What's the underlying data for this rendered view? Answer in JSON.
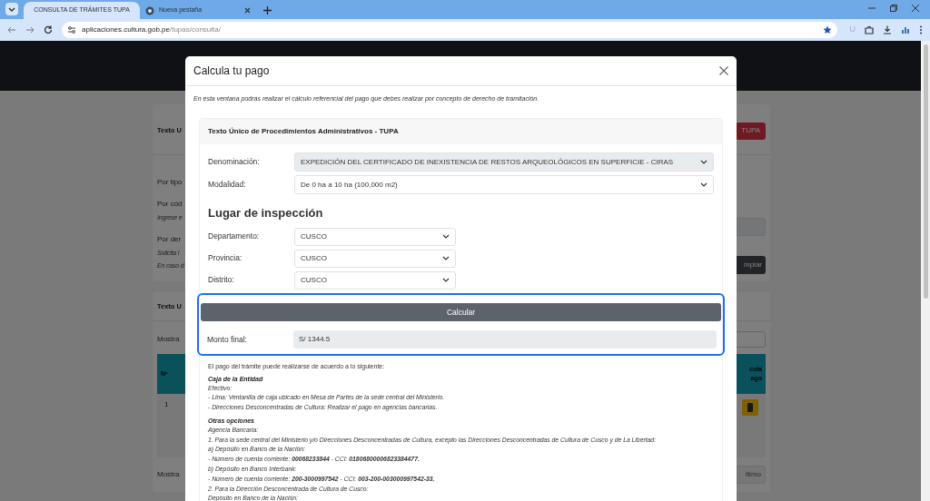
{
  "browser": {
    "tabs": [
      {
        "title": "CONSULTA DE TRÁMITES TUPA",
        "selected": true,
        "kind": "site"
      },
      {
        "title": "Nueva pestaña",
        "selected": false,
        "kind": "globe"
      }
    ],
    "url": {
      "host": "aplicaciones.cultura.gob.pe",
      "path": "/tupas/consulta/"
    },
    "profile_letter": "U"
  },
  "background_page": {
    "search_card": {
      "title": "Texto U",
      "tupa_button": "TUPA",
      "lines": [
        {
          "kind": "label",
          "text": "Por tipo"
        },
        {
          "kind": "label",
          "text": "Por cód"
        },
        {
          "kind": "hint",
          "text": "Ingrese e"
        },
        {
          "kind": "label",
          "text": "Por der"
        },
        {
          "kind": "hint",
          "text": "Solicita l"
        },
        {
          "kind": "hint",
          "text": "En caso d"
        }
      ],
      "clear_button": "mpiar"
    },
    "results_card": {
      "title": "Texto U",
      "show_label": "Mostra",
      "columns": {
        "number": "Nº",
        "last": [
          "cula",
          "ago"
        ]
      },
      "row_number": "1",
      "footer_label": "Mostra",
      "last_button": "ltimo"
    }
  },
  "modal": {
    "title": "Calcula tu pago",
    "intro": "En esta ventana podrás realizar el cálculo referencial del pago que debes realizar por concepto de derecho de tramitación.",
    "section_title": "Texto Único de Procedimientos Administrativos - TUPA",
    "fields": [
      {
        "label": "Denominación:",
        "value": "EXPEDICIÓN DEL CERTIFICADO DE INEXISTENCIA DE RESTOS ARQUEOLÓGICOS EN SUPERFICIE - CIRAS",
        "disabled": true
      },
      {
        "label": "Modalidad:",
        "value": "De 0 ha a 10 ha (100,000 m2)",
        "disabled": false
      }
    ],
    "location_title": "Lugar de inspección",
    "location_fields": [
      {
        "label": "Departamento:",
        "value": "CUSCO"
      },
      {
        "label": "Provincia:",
        "value": "CUSCO"
      },
      {
        "label": "Distrito:",
        "value": "CUSCO"
      }
    ],
    "calculate_button": "Calcular",
    "result": {
      "label": "Monto final:",
      "value": "S/ 1344.5"
    },
    "payment_intro": "El pago del trámite puede realizarse de acuerdo a lo siguiente:",
    "payment_lines": [
      {
        "kind": "heading",
        "text": "Caja de la Entidad"
      },
      {
        "kind": "line",
        "text": "Efectivo:"
      },
      {
        "kind": "line",
        "text": "- Lima: Ventanilla de caja ubicado en Mesa de Partes de la sede central del Ministerio."
      },
      {
        "kind": "line",
        "text": "- Direcciones Desconcentradas de Cultura: Realizar el pago en agencias bancarias."
      },
      {
        "kind": "heading",
        "text": "Otras opciones"
      },
      {
        "kind": "line",
        "text": "Agencia Bancaria:"
      },
      {
        "kind": "line",
        "text": "1. Para la sede central del Ministerio y/o Direcciones Desconcentradas de Cultura, excepto las Direcciones Desconcentradas de Cultura de Cusco y de La Libertad:"
      },
      {
        "kind": "line",
        "text": "a) Depósito en Banco de la Nación:"
      },
      {
        "kind": "line",
        "text": "- Número de cuenta corriente: **00068233844** - CCI: **01806800006823384477.**"
      },
      {
        "kind": "line",
        "text": "b) Depósito en Banco Interbank:"
      },
      {
        "kind": "line",
        "text": "- Número de cuenta corriente: **200-3000997542** - CCI: **003-200-003000997542-33.**"
      },
      {
        "kind": "line",
        "text": "2. Para la Dirección Desconcentrada de Cultura de Cusco:"
      },
      {
        "kind": "line",
        "text": "Depósito en Banco de la Nación:"
      }
    ]
  }
}
